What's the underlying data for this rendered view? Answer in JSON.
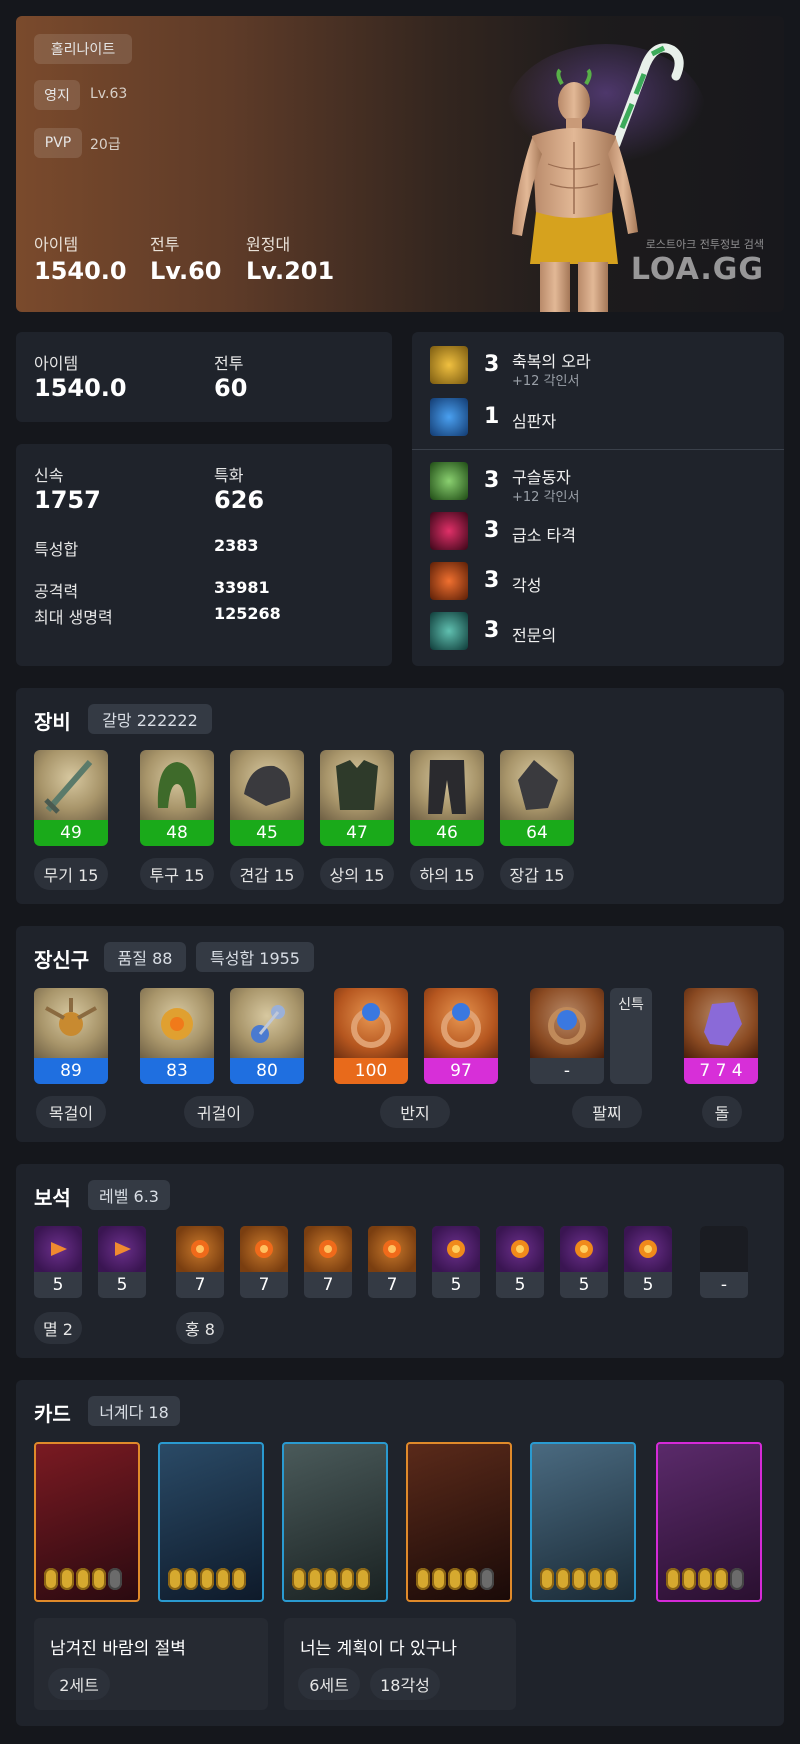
{
  "hero": {
    "class_name": "홀리나이트",
    "rows": [
      {
        "label": "영지",
        "value": "Lv.63"
      },
      {
        "label": "PVP",
        "value": "20급"
      }
    ],
    "stats": [
      {
        "label": "아이템",
        "value": "1540.0"
      },
      {
        "label": "전투",
        "value": "Lv.60"
      },
      {
        "label": "원정대",
        "value": "Lv.201"
      }
    ],
    "watermark_small": "로스트아크 전투정보 검색",
    "watermark_big": "LOA.GG"
  },
  "summary": {
    "item_label": "아이템",
    "item_value": "1540.0",
    "combat_label": "전투",
    "combat_value": "60"
  },
  "stats_panel": {
    "swift_label": "신속",
    "swift_value": "1757",
    "spec_label": "특화",
    "spec_value": "626",
    "total_label": "특성합",
    "total_value": "2383",
    "atk_label": "공격력",
    "atk_value": "33981",
    "hp_label": "최대 생명력",
    "hp_value": "125268"
  },
  "engravings": [
    {
      "level": "3",
      "name": "축복의 오라",
      "sub": "+12 각인서",
      "color": "#c79a24"
    },
    {
      "level": "1",
      "name": "심판자",
      "sub": "",
      "color": "#2a6fc4"
    },
    {
      "level": "3",
      "name": "구슬동자",
      "sub": "+12 각인서",
      "color": "#3c8a2e"
    },
    {
      "level": "3",
      "name": "급소 타격",
      "sub": "",
      "color": "#8a1838"
    },
    {
      "level": "3",
      "name": "각성",
      "sub": "",
      "color": "#c25a1a"
    },
    {
      "level": "3",
      "name": "전문의",
      "sub": "",
      "color": "#2a8a88"
    }
  ],
  "equipment": {
    "title": "장비",
    "tag": "갈망 222222",
    "items": [
      {
        "value": "49",
        "label": "무기 15",
        "icon": "sword-icon"
      },
      {
        "value": "48",
        "label": "투구 15",
        "icon": "helmet-icon"
      },
      {
        "value": "45",
        "label": "견갑 15",
        "icon": "shoulder-icon"
      },
      {
        "value": "47",
        "label": "상의 15",
        "icon": "chest-icon"
      },
      {
        "value": "46",
        "label": "하의 15",
        "icon": "pants-icon"
      },
      {
        "value": "64",
        "label": "장갑 15",
        "icon": "gloves-icon"
      }
    ]
  },
  "accessories": {
    "title": "장신구",
    "tag1": "품질 88",
    "tag2": "특성합 1955",
    "items": [
      {
        "value": "89",
        "icon": "necklace-icon"
      },
      {
        "value": "83",
        "icon": "earring-icon"
      },
      {
        "value": "80",
        "icon": "earring-icon"
      },
      {
        "value": "100",
        "icon": "ring-icon"
      },
      {
        "value": "97",
        "icon": "ring-icon"
      },
      {
        "value": "-",
        "icon": "bracelet-icon"
      },
      {
        "value": "7 7 4",
        "icon": "stone-icon"
      }
    ],
    "bracelet_side": "신특",
    "labels": [
      "목걸이",
      "귀걸이",
      "반지",
      "팔찌",
      "돌"
    ]
  },
  "gems": {
    "title": "보석",
    "tag": "레벨 6.3",
    "items": [
      {
        "value": "5",
        "type": "purple-small"
      },
      {
        "value": "5",
        "type": "purple-small"
      },
      {
        "value": "7",
        "type": "orange"
      },
      {
        "value": "7",
        "type": "orange"
      },
      {
        "value": "7",
        "type": "orange"
      },
      {
        "value": "7",
        "type": "orange"
      },
      {
        "value": "5",
        "type": "purple"
      },
      {
        "value": "5",
        "type": "purple"
      },
      {
        "value": "5",
        "type": "purple"
      },
      {
        "value": "5",
        "type": "purple"
      },
      {
        "value": "-",
        "type": "empty"
      }
    ],
    "labels": [
      "멸 2",
      "홍 8"
    ]
  },
  "cards": {
    "title": "카드",
    "tag": "너계다 18",
    "items": [
      {
        "border": "#e08a2a",
        "bg1": "#7a1a22",
        "bg2": "#2a0a10",
        "stars": 4
      },
      {
        "border": "#2a9ad0",
        "bg1": "#2a4a66",
        "bg2": "#0e1a2a",
        "stars": 5
      },
      {
        "border": "#2a9ad0",
        "bg1": "#4a5a5a",
        "bg2": "#1a2222",
        "stars": 5
      },
      {
        "border": "#e08a2a",
        "bg1": "#5a2a1a",
        "bg2": "#1a0a08",
        "stars": 4
      },
      {
        "border": "#2a9ad0",
        "bg1": "#4a6a80",
        "bg2": "#1a2a36",
        "stars": 5
      },
      {
        "border": "#d52ad8",
        "bg1": "#5a2a6a",
        "bg2": "#2a1030",
        "stars": 4
      }
    ],
    "sets": [
      {
        "title": "남겨진 바람의 절벽",
        "chips": [
          "2세트"
        ]
      },
      {
        "title": "너는 계획이 다 있구나",
        "chips": [
          "6세트",
          "18각성"
        ]
      }
    ]
  }
}
